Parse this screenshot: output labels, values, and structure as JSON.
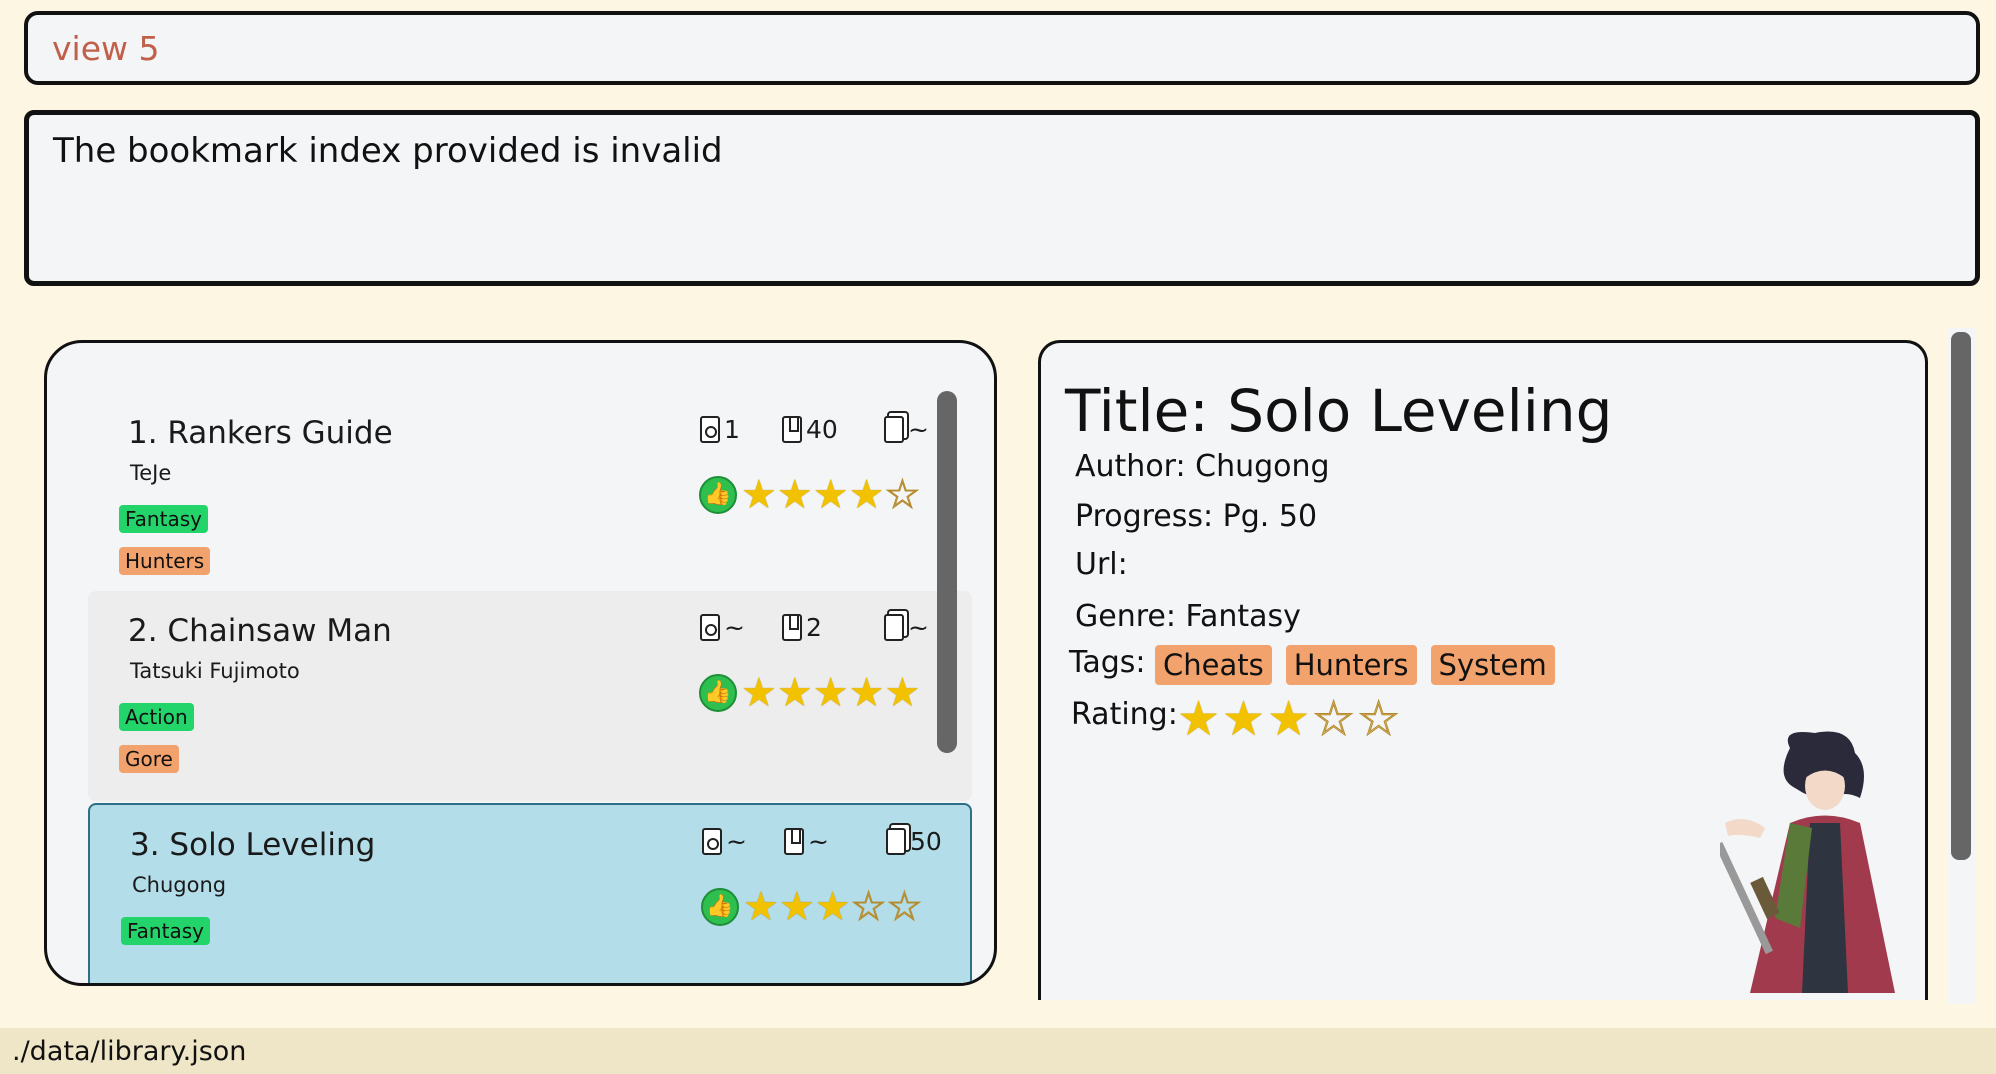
{
  "command_box": {
    "value": "view 5"
  },
  "result_display": {
    "message": "The bookmark index provided is invalid"
  },
  "bookmarks": [
    {
      "title": "1. Rankers Guide",
      "author": "TeJe",
      "genre": "Fantasy",
      "tags": [
        "Hunters"
      ],
      "volume": "1",
      "chapter": "40",
      "page": "~",
      "rating": 4,
      "max_rating": 5
    },
    {
      "title": "2. Chainsaw Man",
      "author": "Tatsuki Fujimoto",
      "genre": "Action",
      "tags": [
        "Gore"
      ],
      "volume": "~",
      "chapter": "2",
      "page": "~",
      "rating": 5,
      "max_rating": 5
    },
    {
      "title": "3. Solo Leveling",
      "author": "Chugong",
      "genre": "Fantasy",
      "tags": [],
      "volume": "~",
      "chapter": "~",
      "page": "50",
      "rating": 3,
      "max_rating": 5
    }
  ],
  "detail": {
    "title": "Title: Solo Leveling",
    "author": "Author: Chugong",
    "progress": "Progress: Pg. 50",
    "url": "Url:",
    "genre": "Genre: Fantasy",
    "tags_label": "Tags:",
    "tags": [
      "Cheats",
      "Hunters",
      "System"
    ],
    "rating_label": "Rating:",
    "rating": 3,
    "max_rating": 5
  },
  "status_bar": {
    "file_path": "./data/library.json"
  },
  "colors": {
    "background": "#fdf6e3",
    "genre_tag": "#22d46a",
    "tag": "#f2a36d",
    "selected_card": "#b3dde9",
    "command_text": "#c0604a"
  }
}
